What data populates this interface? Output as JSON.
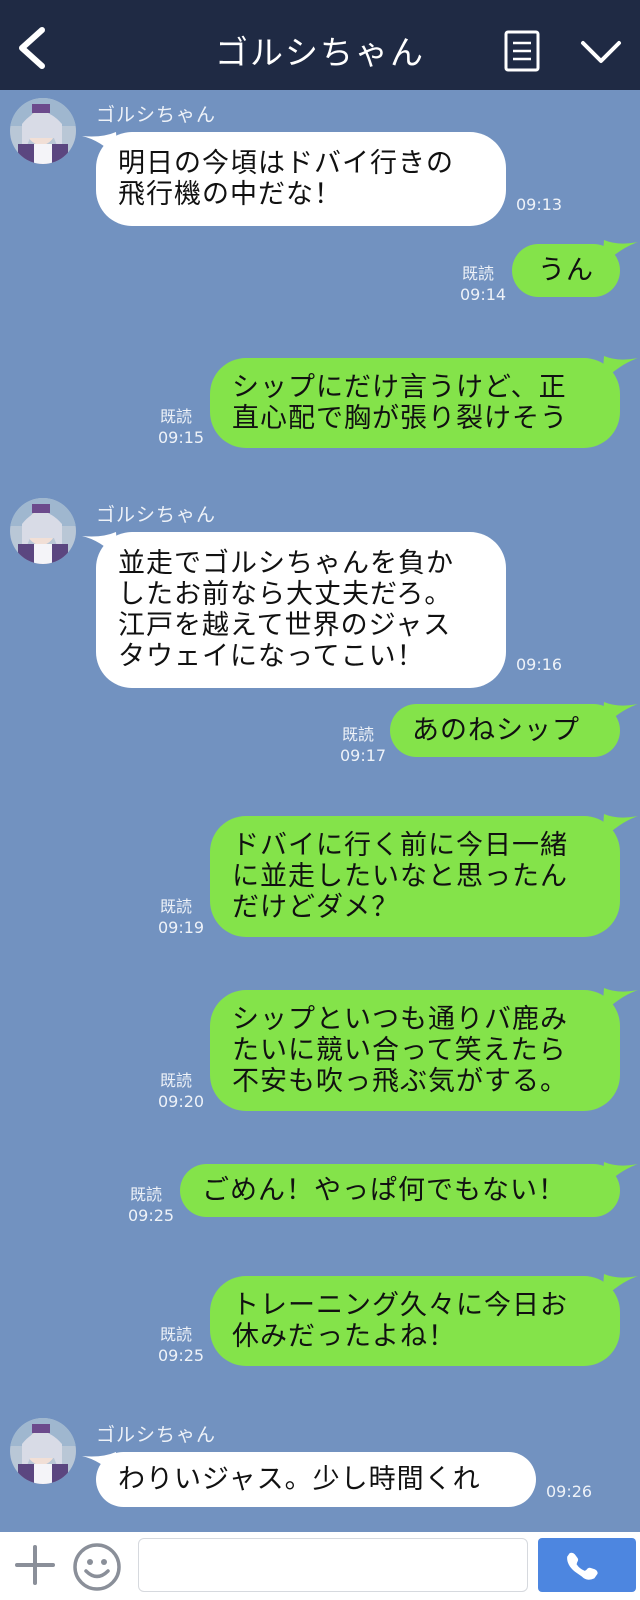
{
  "header": {
    "title": "ゴルシちゃん",
    "back_icon": "back-arrow-icon",
    "menu_icon": "notes-icon",
    "collapse_icon": "chevron-down-icon"
  },
  "colors": {
    "background": "#7292c0",
    "header": "#1f2a44",
    "outgoing_bubble": "#84e34a",
    "incoming_bubble": "#ffffff",
    "call_button": "#4d86e0"
  },
  "messages": [
    {
      "dir": "in",
      "sender": "ゴルシちゃん",
      "text": "明日の今頃はドバイ行きの\n飛行機の中だな！",
      "time": "09:13"
    },
    {
      "dir": "out",
      "read": "既読",
      "text": "うん",
      "time": "09:14"
    },
    {
      "dir": "out",
      "read": "既読",
      "text": "シップにだけ言うけど、正\n直心配で胸が張り裂けそう",
      "time": "09:15"
    },
    {
      "dir": "in",
      "sender": "ゴルシちゃん",
      "text": "並走でゴルシちゃんを負か\nしたお前なら大丈夫だろ。\n江戸を越えて世界のジャス\nタウェイになってこい！",
      "time": "09:16"
    },
    {
      "dir": "out",
      "read": "既読",
      "text": "あのねシップ",
      "time": "09:17"
    },
    {
      "dir": "out",
      "read": "既読",
      "text": "ドバイに行く前に今日一緒\nに並走したいなと思ったん\nだけどダメ？",
      "time": "09:19"
    },
    {
      "dir": "out",
      "read": "既読",
      "text": "シップといつも通りバ鹿み\nたいに競い合って笑えたら\n不安も吹っ飛ぶ気がする。",
      "time": "09:20"
    },
    {
      "dir": "out",
      "read": "既読",
      "text": "ごめん！やっぱ何でもない！",
      "time": "09:25"
    },
    {
      "dir": "out",
      "read": "既読",
      "text": "トレーニング久々に今日お\n休みだったよね！",
      "time": "09:25"
    },
    {
      "dir": "in",
      "sender": "ゴルシちゃん",
      "text": "わりいジャス。少し時間くれ",
      "time": "09:26"
    }
  ],
  "input": {
    "value": "",
    "placeholder": ""
  },
  "bottom": {
    "plus_icon": "plus-icon",
    "emoji_icon": "emoji-icon",
    "call_icon": "phone-icon"
  }
}
